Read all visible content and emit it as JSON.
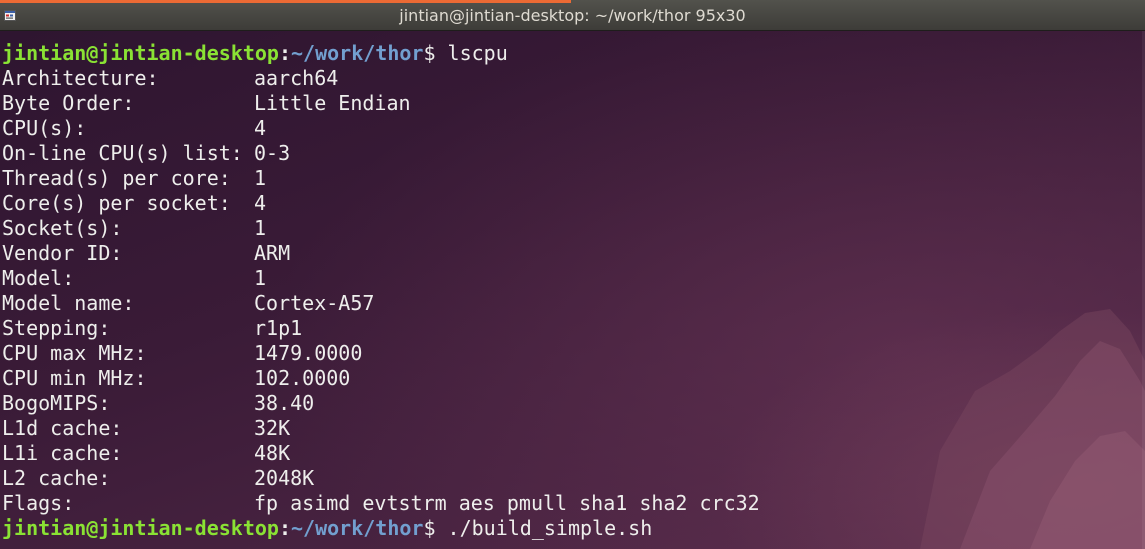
{
  "window": {
    "title": "jintian@jintian-desktop: ~/work/thor 95x30"
  },
  "prompt": {
    "user_host": "jintian@jintian-desktop",
    "colon": ":",
    "path": "~/work/thor",
    "dollar": "$ "
  },
  "commands": {
    "first": "lscpu",
    "second": "./build_simple.sh"
  },
  "lscpu_output": [
    {
      "label": "Architecture:",
      "value": "aarch64"
    },
    {
      "label": "Byte Order:",
      "value": "Little Endian"
    },
    {
      "label": "CPU(s):",
      "value": "4"
    },
    {
      "label": "On-line CPU(s) list:",
      "value": "0-3"
    },
    {
      "label": "Thread(s) per core:",
      "value": "1"
    },
    {
      "label": "Core(s) per socket:",
      "value": "4"
    },
    {
      "label": "Socket(s):",
      "value": "1"
    },
    {
      "label": "Vendor ID:",
      "value": "ARM"
    },
    {
      "label": "Model:",
      "value": "1"
    },
    {
      "label": "Model name:",
      "value": "Cortex-A57"
    },
    {
      "label": "Stepping:",
      "value": "r1p1"
    },
    {
      "label": "CPU max MHz:",
      "value": "1479.0000"
    },
    {
      "label": "CPU min MHz:",
      "value": "102.0000"
    },
    {
      "label": "BogoMIPS:",
      "value": "38.40"
    },
    {
      "label": "L1d cache:",
      "value": "32K"
    },
    {
      "label": "L1i cache:",
      "value": "48K"
    },
    {
      "label": "L2 cache:",
      "value": "2048K"
    },
    {
      "label": "Flags:",
      "value": "fp asimd evtstrm aes pmull sha1 sha2 crc32"
    }
  ],
  "colors": {
    "prompt_user": "#8ae234",
    "prompt_path": "#729fcf",
    "text": "#eeeeec",
    "title_progress": "#ec6a34"
  },
  "icons": {
    "window_icon": "terminal-icon"
  }
}
